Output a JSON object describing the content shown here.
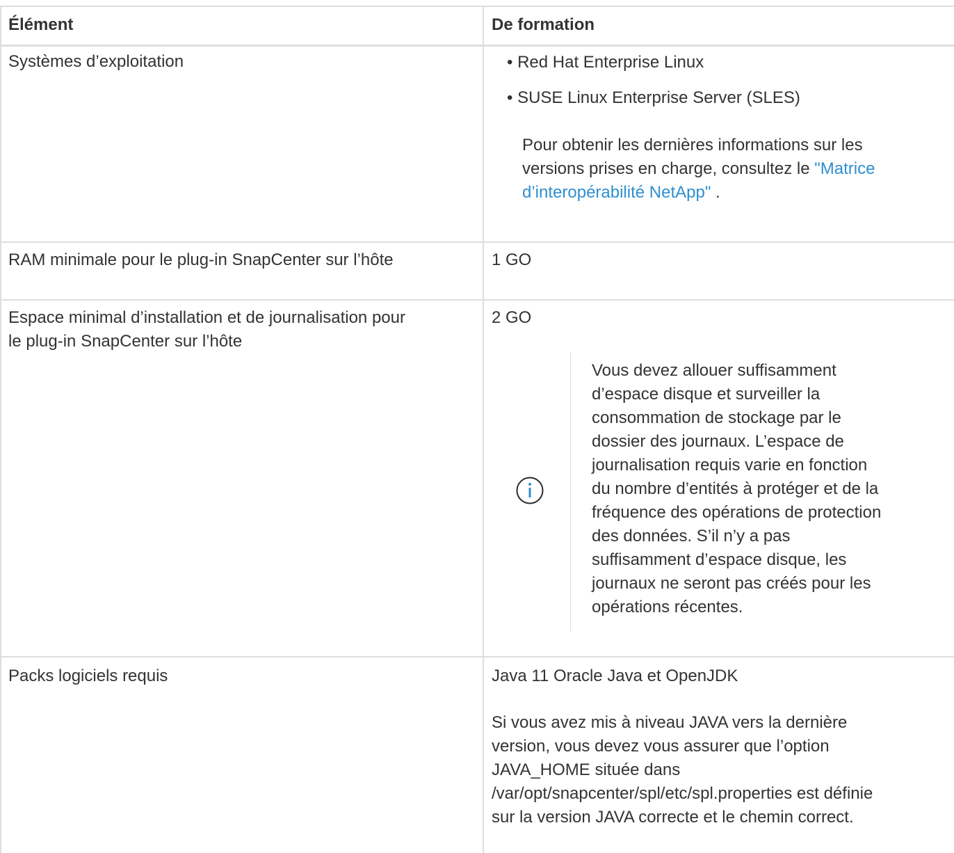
{
  "table": {
    "headers": [
      "Élément",
      "De formation"
    ],
    "rows": [
      {
        "label": "Systèmes d’exploitation",
        "bullets": [
          "Red Hat Enterprise Linux",
          "SUSE Linux Enterprise Server (SLES)"
        ],
        "para_lines": [
          "Pour obtenir les dernières informations sur les",
          "versions prises en charge, consultez le "
        ],
        "link_lines": [
          "\"Matrice",
          "d’interopérabilité NetApp\""
        ],
        "para_tail": " ."
      },
      {
        "label": "RAM minimale pour le plug-in SnapCenter sur l’hôte",
        "value": "1 GO"
      },
      {
        "label_lines": [
          "Espace minimal d’installation et de journalisation pour",
          "le plug-in SnapCenter sur l’hôte"
        ],
        "value": "2 GO",
        "note_icon": "info-icon",
        "note_lines": [
          "Vous devez allouer suffisamment",
          "d’espace disque et surveiller la",
          "consommation de stockage par le",
          "dossier des journaux. L’espace de",
          "journalisation requis varie en fonction",
          "du nombre d’entités à protéger et de la",
          "fréquence des opérations de protection",
          "des données. S’il n’y a pas",
          "suffisamment d’espace disque, les",
          "journaux ne seront pas créés pour les",
          "opérations récentes."
        ]
      },
      {
        "label": "Packs logiciels requis",
        "value": "Java 11 Oracle Java et OpenJDK",
        "para_lines": [
          "Si vous avez mis à niveau JAVA vers la dernière",
          "version, vous devez vous assurer que l’option",
          "JAVA_HOME située dans",
          "/var/opt/snapcenter/spl/etc/spl.properties est définie",
          "sur la version JAVA correcte et le chemin correct."
        ]
      }
    ]
  },
  "colors": {
    "border": "#dedede",
    "text": "#333333",
    "link": "#2f8fd0"
  }
}
